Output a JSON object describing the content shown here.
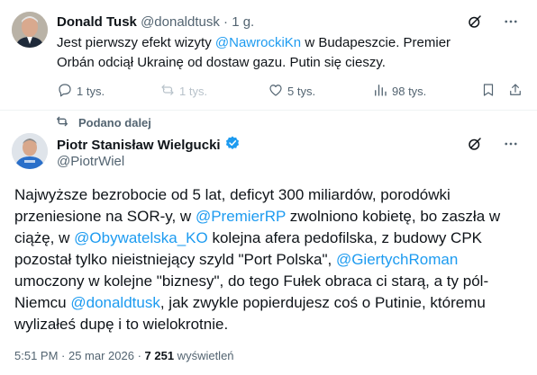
{
  "tweet1": {
    "name": "Donald Tusk",
    "handle": "@donaldtusk",
    "dot": "·",
    "time": "1 g.",
    "body_part1": "Jest pierwszy efekt wizyty ",
    "mention1": "@NawrockiKn",
    "body_part2": " w Budapeszcie. Premier Orbán odciął Ukrainę od dostaw gazu. Putin się cieszy.",
    "actions": {
      "replies": "1 tys.",
      "reposts": "1 tys.",
      "likes": "5 tys.",
      "views": "98 tys."
    }
  },
  "repost_label": "Podano dalej",
  "tweet2": {
    "name": "Piotr Stanisław Wielgucki",
    "handle": "@PiotrWiel",
    "text": {
      "p1": "Najwyższe bezrobocie od 5 lat, deficyt 300 miliardów, porodówki przeniesione na SOR-y, w ",
      "m1": "@PremierRP",
      "p2": " zwolniono kobietę, bo zaszła w ciążę, w ",
      "m2": "@Obywatelska_KO",
      "p3": " kolejna afera pedofilska, z budowy CPK pozostał tylko nieistniejący szyld \"Port Polska\", ",
      "m3": "@GiertychRoman",
      "p4": " umoczony w kolejne \"biznesy\", do tego Fułek obraca ci starą, a ty pól-Niemcu ",
      "m4": "@donaldtusk",
      "p5": ", jak zwykle popierdujesz coś o Putinie, któremu wylizałeś dupę i to wielokrotnie."
    },
    "meta": {
      "time": "5:51 PM · 25 mar 2026 · ",
      "views_count": "7 251",
      "views_label": " wyświetleń"
    }
  },
  "colors": {
    "accent": "#1d9bf0",
    "muted": "#536471",
    "text": "#0f1419"
  },
  "icons": [
    "grok-icon",
    "more-icon",
    "reply-icon",
    "repost-icon",
    "like-icon",
    "views-icon",
    "bookmark-icon",
    "verified-badge-icon"
  ]
}
